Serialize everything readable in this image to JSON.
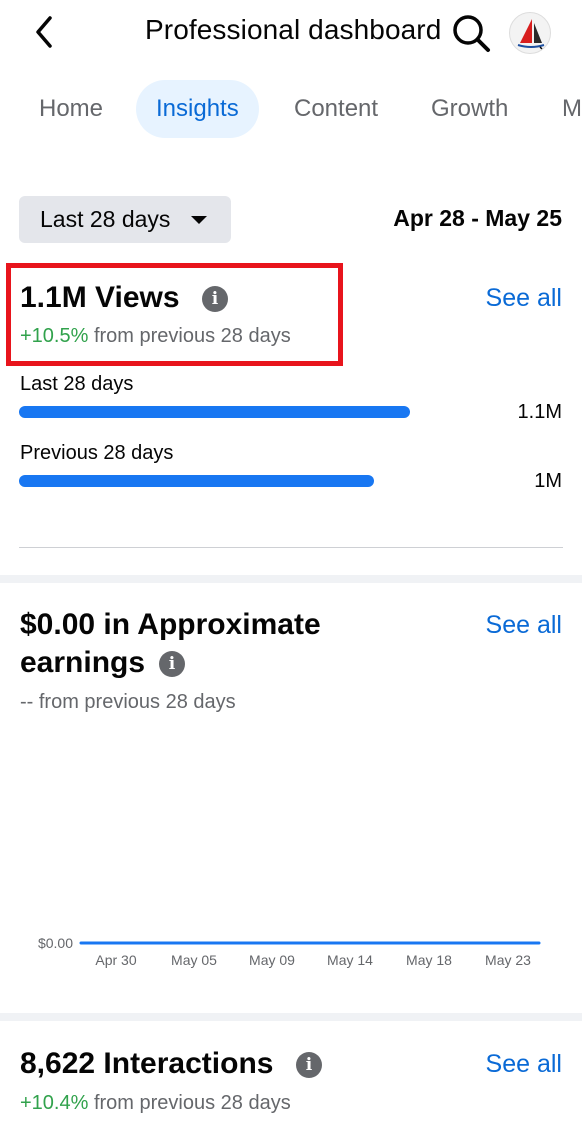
{
  "header": {
    "title": "Professional dashboard"
  },
  "tabs": [
    {
      "label": "Home",
      "active": false
    },
    {
      "label": "Insights",
      "active": true
    },
    {
      "label": "Content",
      "active": false
    },
    {
      "label": "Growth",
      "active": false
    },
    {
      "label": "M",
      "active": false
    }
  ],
  "filter": {
    "selected": "Last 28 days",
    "date_range": "Apr 28 - May 25"
  },
  "views": {
    "title": "1.1M Views",
    "see_all": "See all",
    "change": "+10.5%",
    "change_text": " from previous 28 days",
    "bars": [
      {
        "label": "Last 28 days",
        "value_text": "1.1M",
        "value": 1.1
      },
      {
        "label": "Previous 28 days",
        "value_text": "1M",
        "value": 1.0
      }
    ]
  },
  "earnings": {
    "title_line1": "$0.00 in Approximate",
    "title_line2": "earnings",
    "see_all": "See all",
    "change": "-- from previous 28 days"
  },
  "chart_data": {
    "type": "area",
    "x": [
      "Apr 30",
      "May 05",
      "May 09",
      "May 14",
      "May 18",
      "May 23"
    ],
    "y_tick_labels": [
      "$0.00"
    ],
    "series": [
      {
        "values": [
          0,
          0,
          0,
          0,
          0,
          0
        ]
      }
    ],
    "grid": false
  },
  "interactions": {
    "title": "8,622 Interactions",
    "see_all": "See all",
    "change": "+10.4%",
    "change_text": " from previous 28 days"
  },
  "colors": {
    "accent": "#0a6ad6",
    "bar": "#1877f2",
    "positive": "#31a24c",
    "highlight": "#e8141c",
    "area_fill": "#e2efff"
  },
  "icons": {
    "back": "chevron-left-icon",
    "search": "search-icon",
    "info": "info-icon",
    "dropdown": "caret-down-icon"
  }
}
